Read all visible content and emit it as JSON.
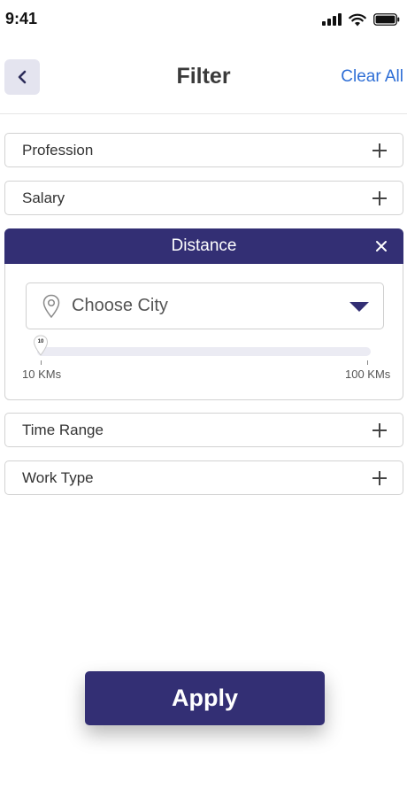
{
  "status_bar": {
    "time": "9:41",
    "icons": [
      "cellular-signal-icon",
      "wifi-icon",
      "battery-icon"
    ]
  },
  "header": {
    "back_icon": "chevron-left-icon",
    "title": "Filter",
    "clear_all": "Clear All"
  },
  "filters": {
    "profession": {
      "label": "Profession",
      "icon": "plus-icon"
    },
    "salary": {
      "label": "Salary",
      "icon": "plus-icon"
    },
    "distance": {
      "title": "Distance",
      "close_icon": "close-icon",
      "city_select": {
        "placeholder": "Choose City",
        "icon": "map-pin-icon",
        "caret_icon": "caret-down-icon"
      },
      "slider": {
        "value": 10,
        "min": 10,
        "max": 100,
        "min_label": "10 KMs",
        "max_label": "100 KMs"
      }
    },
    "time_range": {
      "label": "Time Range",
      "icon": "plus-icon"
    },
    "work_type": {
      "label": "Work Type",
      "icon": "plus-icon"
    }
  },
  "apply_button": {
    "label": "Apply"
  },
  "colors": {
    "primary": "#332f74",
    "link": "#2f6fd6",
    "back_button_bg": "#e4e4ef",
    "border": "#d2d2d2",
    "track": "#ebebf3"
  }
}
